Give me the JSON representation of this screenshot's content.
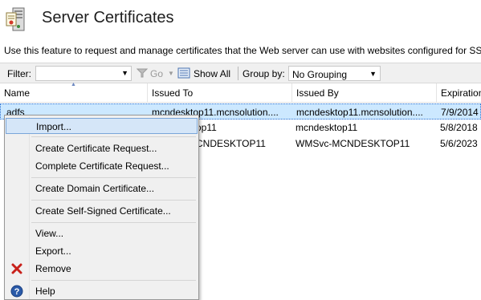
{
  "header": {
    "title": "Server Certificates",
    "icon": "server-certificate-icon"
  },
  "description": "Use this feature to request and manage certificates that the Web server can use with websites configured for SSL.",
  "toolbar": {
    "filter_label": "Filter:",
    "filter_value": "",
    "go_label": "Go",
    "show_all_label": "Show All",
    "group_by_label": "Group by:",
    "group_by_value": "No Grouping"
  },
  "table": {
    "columns": [
      "Name",
      "Issued To",
      "Issued By",
      "Expiration"
    ],
    "rows": [
      {
        "name": "adfs",
        "issued_to": "mcndesktop11.mcnsolution....",
        "issued_by": "mcndesktop11.mcnsolution....",
        "expiration": "7/9/2014"
      },
      {
        "name": "",
        "issued_to": "op11",
        "issued_by": "mcndesktop11",
        "expiration": "5/8/2018"
      },
      {
        "name": "",
        "issued_to": "CNDESKTOP11",
        "issued_by": "WMSvc-MCNDESKTOP11",
        "expiration": "5/6/2023"
      }
    ]
  },
  "context_menu": {
    "items": [
      {
        "label": "Import..."
      },
      {
        "label": "Create Certificate Request..."
      },
      {
        "label": "Complete Certificate Request..."
      },
      {
        "label": "Create Domain Certificate..."
      },
      {
        "label": "Create Self-Signed Certificate..."
      },
      {
        "label": "View..."
      },
      {
        "label": "Export..."
      },
      {
        "label": "Remove",
        "icon": "red-x-icon"
      },
      {
        "label": "Help",
        "icon": "help-icon"
      }
    ]
  },
  "colors": {
    "selection": "#cce8ff",
    "menu_hover": "#d5e6f8",
    "remove_red": "#c8201a",
    "help_blue": "#2a5aa8"
  }
}
